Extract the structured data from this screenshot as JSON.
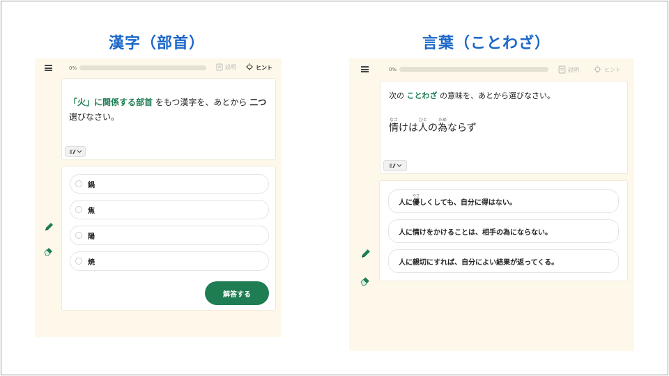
{
  "left": {
    "heading": "漢字（部首）",
    "progress": {
      "percent_label": "0%",
      "value": 0
    },
    "toolbar": {
      "explanation_label": "説明",
      "hint_label": "ヒント"
    },
    "question": {
      "highlight": "「火」に関係する部首",
      "text_middle": "をもつ漢字を、あとから",
      "count": "二つ",
      "text_line2": "選びなさい。"
    },
    "options": [
      "鍋",
      "焦",
      "陽",
      "焼"
    ],
    "answer_button": "解答する"
  },
  "right": {
    "heading": "言葉（ことわざ）",
    "progress": {
      "percent_label": "0%",
      "value": 0
    },
    "toolbar": {
      "explanation_label": "説明",
      "hint_label": "ヒント"
    },
    "question": {
      "prefix": "次の",
      "highlight": "ことわざ",
      "suffix": "の意味を、あとから選びなさい。",
      "proverb": "情けは人の為ならず",
      "ruby": {
        "nasa": "なさ",
        "hito": "ひと",
        "tame": "ため"
      }
    },
    "options": [
      {
        "pre": "人に",
        "ruby_word": "優",
        "ruby": "やさ",
        "post": "しくしても、自分に得はない。"
      },
      {
        "pre": "人に情けをかけることは、相手の為にならない。"
      },
      {
        "pre": "人に親切にすれば、自分によい結果が返ってくる。"
      }
    ]
  },
  "colors": {
    "accent": "#1e7d52",
    "heading": "#1b67c9",
    "panel": "#fdf8ea"
  },
  "icons": [
    "menu-icon",
    "memo-icon",
    "bulb-icon",
    "pencil-icon",
    "eraser-icon",
    "chevron-down-icon"
  ]
}
